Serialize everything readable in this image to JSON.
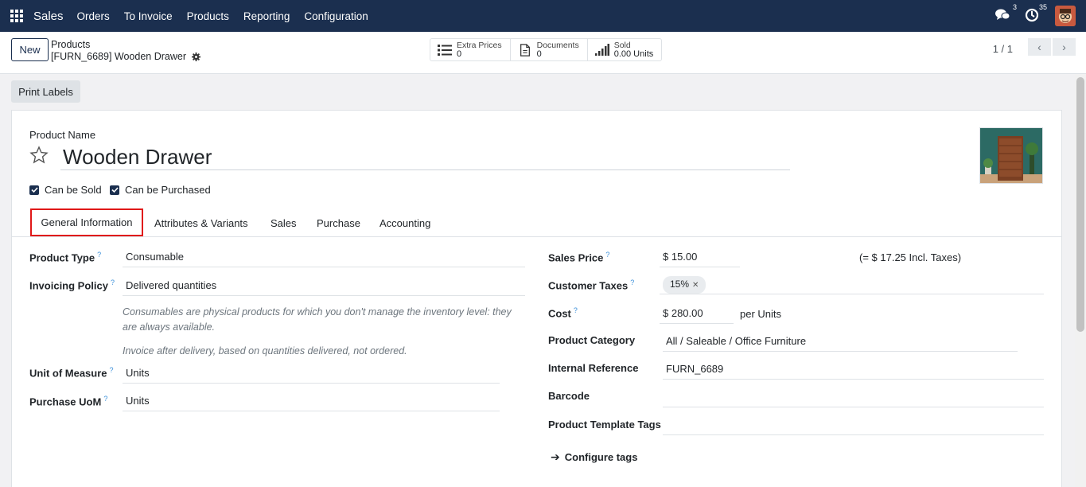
{
  "navbar": {
    "brand": "Sales",
    "menu": [
      "Orders",
      "To Invoice",
      "Products",
      "Reporting",
      "Configuration"
    ],
    "messages_count": "3",
    "activities_count": "35"
  },
  "control": {
    "new_label": "New",
    "breadcrumb_parent": "Products",
    "breadcrumb_current": "[FURN_6689] Wooden Drawer",
    "stats": [
      {
        "label": "Extra Prices",
        "value": "0",
        "icon": "list-icon"
      },
      {
        "label": "Documents",
        "value": "0",
        "icon": "document-icon"
      },
      {
        "label": "Sold",
        "value": "0.00 Units",
        "icon": "bar-signal-icon"
      }
    ],
    "pager": "1 / 1"
  },
  "actions": {
    "print_labels": "Print Labels"
  },
  "form": {
    "product_name_label": "Product Name",
    "product_name": "Wooden Drawer",
    "can_be_sold": "Can be Sold",
    "can_be_purchased": "Can be Purchased",
    "tabs": [
      "General Information",
      "Attributes & Variants",
      "Sales",
      "Purchase",
      "Accounting"
    ],
    "left": {
      "product_type_label": "Product Type",
      "product_type": "Consumable",
      "invoicing_policy_label": "Invoicing Policy",
      "invoicing_policy": "Delivered quantities",
      "note_consumable": "Consumables are physical products for which you don't manage the inventory level: they are always available.",
      "note_invoice": "Invoice after delivery, based on quantities delivered, not ordered.",
      "uom_label": "Unit of Measure",
      "uom": "Units",
      "purchase_uom_label": "Purchase UoM",
      "purchase_uom": "Units"
    },
    "right": {
      "sales_price_label": "Sales Price",
      "sales_price": "$ 15.00",
      "incl_taxes": "(= $ 17.25 Incl. Taxes)",
      "customer_taxes_label": "Customer Taxes",
      "customer_tax_tag": "15%",
      "cost_label": "Cost",
      "cost": "$ 280.00",
      "cost_unit": "per Units",
      "category_label": "Product Category",
      "category": "All / Saleable / Office Furniture",
      "internal_ref_label": "Internal Reference",
      "internal_ref": "FURN_6689",
      "barcode_label": "Barcode",
      "barcode": "",
      "template_tags_label": "Product Template Tags",
      "template_tags": "",
      "configure_tags": "Configure tags"
    }
  },
  "colors": {
    "navbar": "#1b2f4f",
    "active_tab_outline": "#e01818",
    "help_mark": "#3a8fd9"
  }
}
